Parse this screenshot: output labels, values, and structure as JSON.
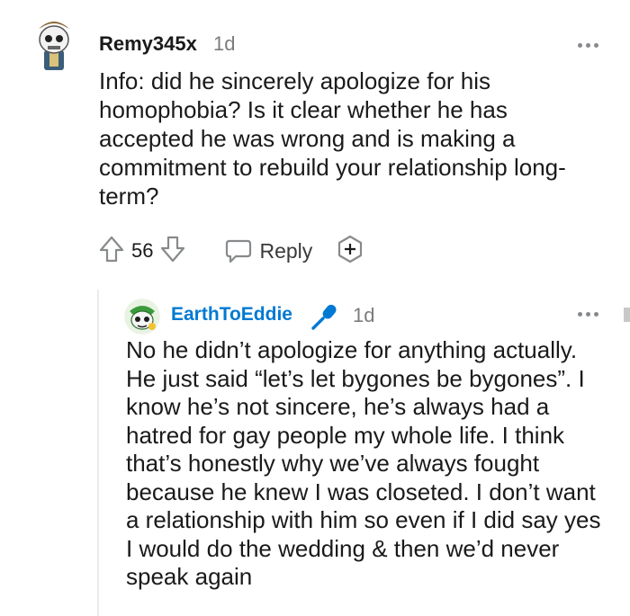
{
  "comments": [
    {
      "username": "Remy345x",
      "age": "1d",
      "body": "Info: did he sincerely apologize for his homophobia? Is it clear whether he has accepted he was wrong and is making a commitment to rebuild your relationship long-term?",
      "score": "56",
      "reply_label": "Reply",
      "icons": {
        "avatar": "avatar-icon",
        "upvote": "upvote-arrow-icon",
        "downvote": "downvote-arrow-icon",
        "reply": "speech-bubble-icon",
        "award": "award-plus-icon",
        "more": "more-dots-icon"
      }
    },
    {
      "username": "EarthToEddie",
      "age": "1d",
      "body": "No he didn’t apologize for anything actually. He just said “let’s let bygones be bygones”. I know he’s not sincere, he’s always had a hatred for gay people my whole life. I think that’s honestly why we’ve always fought because he knew I was closeted. I don’t want a relationship with him so even if I did say yes I would do the wedding & then we’d never speak again",
      "badge_icon": "microphone-icon",
      "username_color": "#0079d3"
    }
  ]
}
